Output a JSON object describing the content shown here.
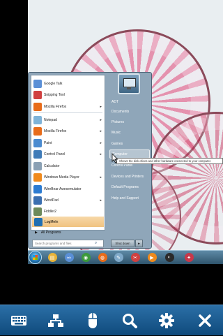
{
  "start_menu": {
    "left_items": [
      {
        "label": "Google Talk",
        "icon": "google-talk-icon",
        "color": "#5a8fd6",
        "arrow": false
      },
      {
        "label": "Snipping Tool",
        "icon": "snipping-tool-icon",
        "color": "#d04040",
        "arrow": false
      },
      {
        "label": "Mozilla Firefox",
        "icon": "firefox-icon",
        "color": "#e86c1a",
        "arrow": true
      },
      {
        "label": "Notepad",
        "icon": "notepad-icon",
        "color": "#7fb3d8",
        "arrow": true
      },
      {
        "label": "Mozilla Firefox",
        "icon": "firefox-icon",
        "color": "#e86c1a",
        "arrow": true
      },
      {
        "label": "Paint",
        "icon": "paint-icon",
        "color": "#4b8bd0",
        "arrow": true
      },
      {
        "label": "Control Panel",
        "icon": "control-panel-icon",
        "color": "#3f7bb8",
        "arrow": true
      },
      {
        "label": "Calculator",
        "icon": "calculator-icon",
        "color": "#8aa0b4",
        "arrow": false
      },
      {
        "label": "Windows Media Player",
        "icon": "media-player-icon",
        "color": "#f08a1c",
        "arrow": true
      },
      {
        "label": "WireBear Awesemulator",
        "icon": "wirebear-icon",
        "color": "#2c7bd1",
        "arrow": false
      },
      {
        "label": "WordPad",
        "icon": "wordpad-icon",
        "color": "#3b6fb0",
        "arrow": true
      },
      {
        "label": "Fiddler2",
        "icon": "fiddler-icon",
        "color": "#6d8a5a",
        "arrow": false
      }
    ],
    "logmein": {
      "label": "LogMeIn",
      "icon": "logmein-icon"
    },
    "all_programs": "All Programs",
    "search_placeholder": "Search programs and files",
    "right_items": [
      "ADT",
      "Documents",
      "Pictures",
      "Music",
      "Games",
      "Computer",
      "Control Panel",
      "Devices and Printers",
      "Default Programs",
      "Help and Support"
    ],
    "hovered_right_item": "Computer",
    "shutdown_label": "Shut down"
  },
  "tooltip": "Shows the disk drives and other hardware connected to your computer.",
  "taskbar": {
    "items": [
      {
        "icon": "explorer-icon",
        "color": "#e8b339",
        "glyph": "▤"
      },
      {
        "icon": "google-talk-icon",
        "color": "#5a8fd6",
        "glyph": "talk"
      },
      {
        "icon": "chrome-icon",
        "color": "#3c9a3c",
        "glyph": "◉"
      },
      {
        "icon": "firefox-icon",
        "color": "#e86c1a",
        "glyph": "◍"
      },
      {
        "icon": "pen-icon",
        "color": "#7fa9c9",
        "glyph": "✎"
      },
      {
        "icon": "snipping-tool-icon",
        "color": "#d04040",
        "glyph": "✂"
      },
      {
        "icon": "media-player-icon",
        "color": "#f08a1c",
        "glyph": "▶"
      },
      {
        "icon": "speaker-icon",
        "color": "#2a2a2a",
        "glyph": "◐"
      },
      {
        "icon": "network-icon",
        "color": "#c8384a",
        "glyph": "✦"
      }
    ]
  },
  "toolbar": {
    "buttons": [
      "keyboard-icon",
      "hierarchy-icon",
      "mouse-icon",
      "zoom-icon",
      "settings-icon",
      "close-icon"
    ]
  }
}
